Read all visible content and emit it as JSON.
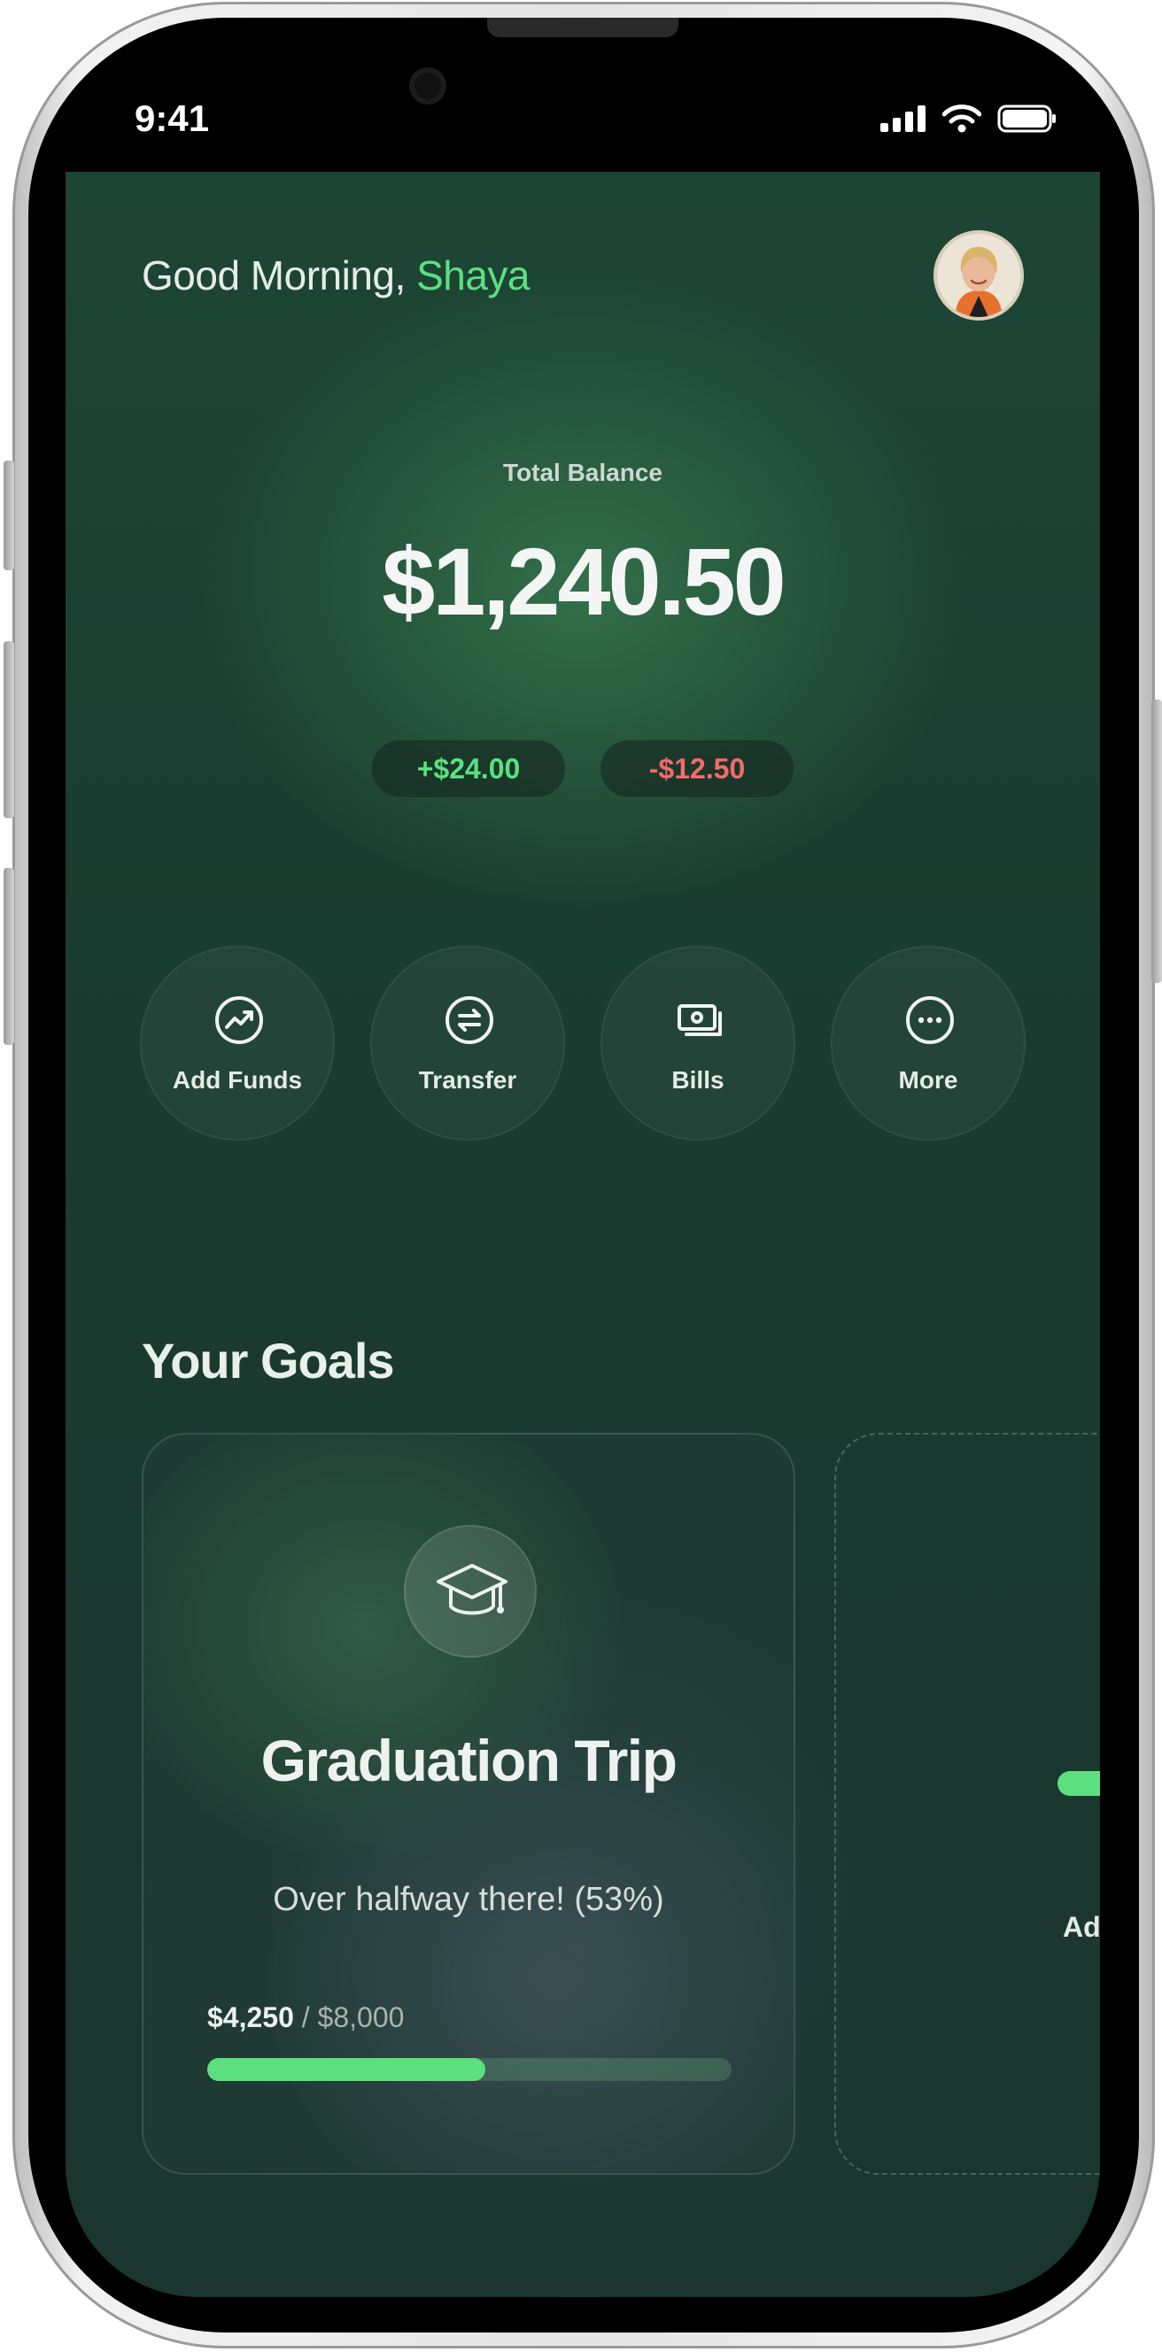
{
  "status_bar": {
    "time": "9:41"
  },
  "header": {
    "greeting": "Good Morning,",
    "user_name": "Shaya"
  },
  "balance": {
    "label": "Total Balance",
    "amount": "$1,240.50",
    "income": "+$24.00",
    "expense": "-$12.50"
  },
  "actions": [
    {
      "label": "Add Funds",
      "icon": "trend-up-icon"
    },
    {
      "label": "Transfer",
      "icon": "transfer-icon"
    },
    {
      "label": "Bills",
      "icon": "bills-icon"
    },
    {
      "label": "More",
      "icon": "more-icon"
    }
  ],
  "goals": {
    "title": "Your Goals",
    "items": [
      {
        "name": "Graduation Trip",
        "icon": "graduation-cap-icon",
        "subtitle": "Over halfway there! (53%)",
        "saved": "$4,250",
        "target": "/ $8,000",
        "progress": 0.53
      }
    ],
    "add_label": "Add"
  },
  "colors": {
    "accent_green": "#5ce07f",
    "negative_red": "#f26b6b",
    "background": "#1b3b30"
  }
}
